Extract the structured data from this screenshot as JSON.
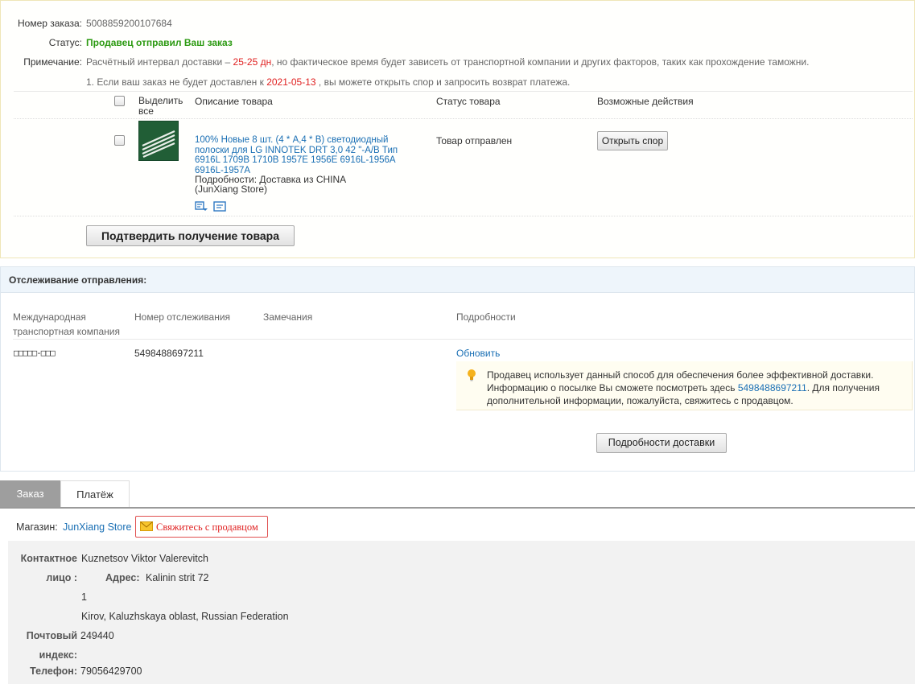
{
  "order": {
    "number_label": "Номер заказа:",
    "number": "5008859200107684",
    "status_label": "Статус:",
    "status": "Продавец отправил Ваш заказ",
    "note_label": "Примечание:",
    "note_pre": "Расчётный интервал доставки –",
    "note_days": "25-25 дн",
    "note_post": ", но фактическое время будет зависеть от транспортной компании и других факторов, таких как прохождение таможни.",
    "note2_pre": "1. Если ваш заказ не будет доставлен к",
    "note2_date": "2021-05-13",
    "note2_post": ", вы можете открыть спор и запросить возврат платежа.",
    "colors": {
      "status": "#2c9a12",
      "highlight": "#e02020",
      "link": "#1a6fb4"
    }
  },
  "products_table": {
    "headers": {
      "select_all": "Выделить все",
      "description": "Описание товара",
      "status": "Статус товара",
      "actions": "Возможные действия"
    },
    "item": {
      "title": "100% Новые 8 шт. (4 * A,4 * B) светодиодный полоски для LG INNOTEK DRT 3,0 42 \"-A/B Тип 6916L 1709B 1710B 1957E 1956E 6916L-1956A 6916L-1957A",
      "details": "Подробности: Доставка из CHINA",
      "store_note": "(JunXiang Store)",
      "status": "Товар отправлен",
      "dispute_button": "Открыть спор",
      "icons": [
        "snapshot-icon",
        "order-detail-icon"
      ]
    },
    "confirm_button": "Подтвердить получение товара"
  },
  "tracking": {
    "title": "Отслеживание отправления:",
    "headers": {
      "carrier": "Международная транспортная компания",
      "tracking_number": "Номер отслеживания",
      "remarks": "Замечания",
      "details": "Подробности"
    },
    "carrier": "□□□□□-□□□",
    "tracking_number": "5498488697211",
    "refresh_link": "Обновить",
    "info_line1": "Продавец использует данный способ для обеспечения более эффективной доставки.",
    "info_line2_pre": "Информацию о посылке Вы сможете посмотреть здесь",
    "info_link": "5498488697211",
    "info_line2_post": ". Для получения",
    "info_line3": "дополнительной информации, пожалуйста, свяжитесь с продавцом.",
    "delivery_details_button": "Подробности доставки",
    "icons": [
      "bulb-icon"
    ]
  },
  "tabs": [
    {
      "label": "Заказ",
      "active": true
    },
    {
      "label": "Платёж",
      "active": false
    }
  ],
  "shop": {
    "label": "Магазин:",
    "name": "JunXiang Store",
    "contact_button": "Свяжитесь с продавцом",
    "icons": [
      "envelope-icon"
    ]
  },
  "address": {
    "contact_label": "Контактное лицо :",
    "contact": "Kuznetsov Viktor Valerevitch",
    "address_label": "Адрес:",
    "address_line1": "Kalinin strit 72",
    "address_line2": "1",
    "address_line3": "Kirov, Kaluzhskaya oblast, Russian Federation",
    "zip_label": "Почтовый индекс:",
    "zip": "249440",
    "phone_label": "Телефон:",
    "phone": "79056429700"
  }
}
